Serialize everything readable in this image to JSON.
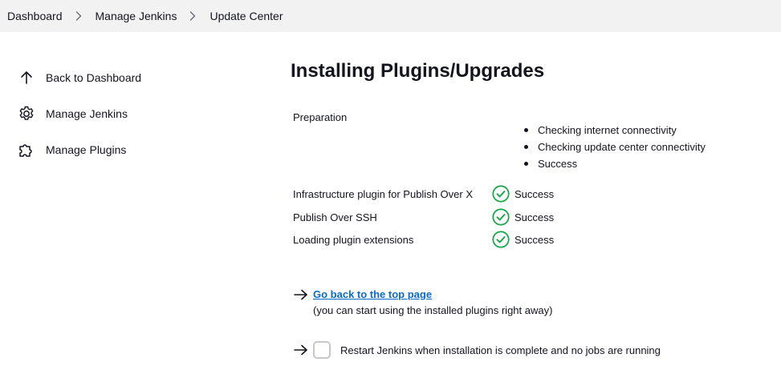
{
  "breadcrumb": {
    "items": [
      "Dashboard",
      "Manage Jenkins",
      "Update Center"
    ]
  },
  "sidebar": {
    "items": [
      {
        "label": "Back to Dashboard",
        "icon": "arrow-up-icon"
      },
      {
        "label": "Manage Jenkins",
        "icon": "gear-icon"
      },
      {
        "label": "Manage Plugins",
        "icon": "puzzle-icon"
      }
    ]
  },
  "main": {
    "title": "Installing Plugins/Upgrades",
    "preparation": {
      "label": "Preparation",
      "steps": [
        "Checking internet connectivity",
        "Checking update center connectivity",
        "Success"
      ]
    },
    "jobs": [
      {
        "name": "Infrastructure plugin for Publish Over X",
        "status": "Success"
      },
      {
        "name": "Publish Over SSH",
        "status": "Success"
      },
      {
        "name": "Loading plugin extensions",
        "status": "Success"
      }
    ],
    "top_link": {
      "label": "Go back to the top page",
      "hint": "(you can start using the installed plugins right away)"
    },
    "restart": {
      "label": "Restart Jenkins when installation is complete and no jobs are running",
      "checked": false
    }
  },
  "colors": {
    "success": "#1ea64b",
    "link": "#0b6bc9",
    "breadcrumb_bg": "#f2f2f3"
  }
}
